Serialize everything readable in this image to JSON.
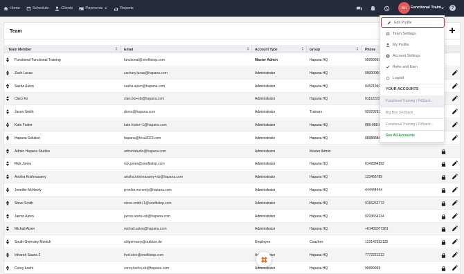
{
  "nav": {
    "items": [
      {
        "label": "Home",
        "icon": "home-icon"
      },
      {
        "label": "Schedule",
        "icon": "calendar-icon"
      },
      {
        "label": "Clients",
        "icon": "person-icon"
      },
      {
        "label": "Payments",
        "icon": "payments-icon"
      },
      {
        "label": "Reports",
        "icon": "chart-icon"
      }
    ]
  },
  "topright": {
    "avatar_initials": "AH",
    "account_name": "Functional Traini..."
  },
  "team": {
    "title": "Team"
  },
  "table": {
    "columns": [
      "Team Member",
      "Email",
      "Account Type",
      "Group",
      "Phone"
    ],
    "rows": [
      {
        "member": "Functional Functional Training",
        "email": "functional@onefitstop.com",
        "type": "Master Admin",
        "group": "Hapana HQ",
        "phone": "99999999",
        "lock": false,
        "edit": false,
        "bold_type": true
      },
      {
        "member": "Zach Lucas",
        "email": "zachary.lucas@hapana.com",
        "type": "Administrator",
        "group": "Hapana HQ",
        "phone": "0000000000",
        "lock": false,
        "edit": true
      },
      {
        "member": "Sasha Aizen",
        "email": "sasha.aizen@hapana.com",
        "type": "Administrator",
        "group": "Hapana HQ",
        "phone": "0452194032",
        "lock": false,
        "edit": true
      },
      {
        "member": "Claro Ko",
        "email": "claro.ko+sb@hapana.com",
        "type": "Administrator",
        "group": "Hapana HQ",
        "phone": "0111222333",
        "lock": false,
        "edit": true
      },
      {
        "member": "Jason Smith",
        "email": "demo@hapana.com",
        "type": "Administrator",
        "group": "Trainers",
        "phone": "9292929292",
        "lock": false,
        "edit": true
      },
      {
        "member": "Kate Foster",
        "email": "kate.foster+1@hapana.com",
        "type": "Administrator",
        "group": "Hapana HQ",
        "phone": "888-888-8888",
        "lock": false,
        "edit": true
      },
      {
        "member": "Hapana Solution",
        "email": "hapana@hrsa2023.com",
        "type": "Administrator",
        "group": "Hapana HQ",
        "phone": "8888888888",
        "lock": false,
        "edit": true
      },
      {
        "member": "Admin Hapana Studios",
        "email": "adminfstudio@hapana.com",
        "type": "Administrator",
        "group": "Master Admin",
        "phone": "",
        "lock": true,
        "edit": false
      },
      {
        "member": "Rick Jones",
        "email": "rick.jones@onefitstop.com",
        "type": "Administrator",
        "group": "Hapana HQ",
        "phone": "6142884892",
        "lock": true,
        "edit": true
      },
      {
        "member": "Anisha Krishnasamy",
        "email": "anisha.krishnasamy+sb@hapana.com",
        "type": "Administrator",
        "group": "Hapana HQ",
        "phone": "123456789",
        "lock": true,
        "edit": true
      },
      {
        "member": "Jennifer McNeely",
        "email": "jennifer.mcneely@hapana.com",
        "type": "Administrator",
        "group": "Hapana HQ",
        "phone": "444444444",
        "lock": true,
        "edit": true
      },
      {
        "member": "Steve Smith",
        "email": "steve.smith+1@onefitstop.com",
        "type": "Administrator",
        "group": "Hapana HQ",
        "phone": "9166262772",
        "lock": true,
        "edit": true
      },
      {
        "member": "Jarron Aizen",
        "email": "jarron.aizen+sb@hapana.com",
        "type": "Administrator",
        "group": "Hapana HQ",
        "phone": "9293654234",
        "lock": true,
        "edit": true
      },
      {
        "member": "Michali Aizen",
        "email": "michali.aizen@hapana.com",
        "type": "Administrator",
        "group": "Hapana HQ",
        "phone": "+61403077281",
        "lock": true,
        "edit": true
      },
      {
        "member": "South Germany Munich",
        "email": "sthgermany@outdoor.de",
        "type": "Employee",
        "group": "Coaches",
        "phone": "123142352125",
        "lock": true,
        "edit": true
      },
      {
        "member": "Infrared Sauna 2",
        "email": "fred.eiee@onefitstop.com",
        "type": "Administrator",
        "group": "Hapana HQ",
        "phone": "7772221212",
        "lock": true,
        "edit": true
      },
      {
        "member": "Corey Loehr",
        "email": "corey.loehr+sb@hapana.com",
        "type": "Administrator",
        "group": "Hapana HQ",
        "phone": "99999999",
        "lock": true,
        "edit": true
      }
    ]
  },
  "dropdown": {
    "items": [
      {
        "label": "Edit Profile",
        "icon": "pencil-icon"
      },
      {
        "label": "Team Settings",
        "icon": "team-icon"
      },
      {
        "label": "My Profile",
        "icon": "person-icon"
      },
      {
        "label": "Account Settings",
        "icon": "gear-icon"
      },
      {
        "label": "Refer and Earn",
        "icon": "check-icon"
      },
      {
        "label": "Logout",
        "icon": "power-icon"
      }
    ],
    "section_title": "YOUR ACCOUNTS",
    "accounts": [
      "Functional Training | FitStack...",
      "Big Box | FitStack",
      "Functional Training | FitStack..."
    ],
    "see_all": "See All Accounts"
  },
  "colors": {
    "topbar": "#262b3c",
    "avatar": "#e25a5a",
    "active_outline": "#d5262d",
    "see_all": "#2c9a4a"
  }
}
